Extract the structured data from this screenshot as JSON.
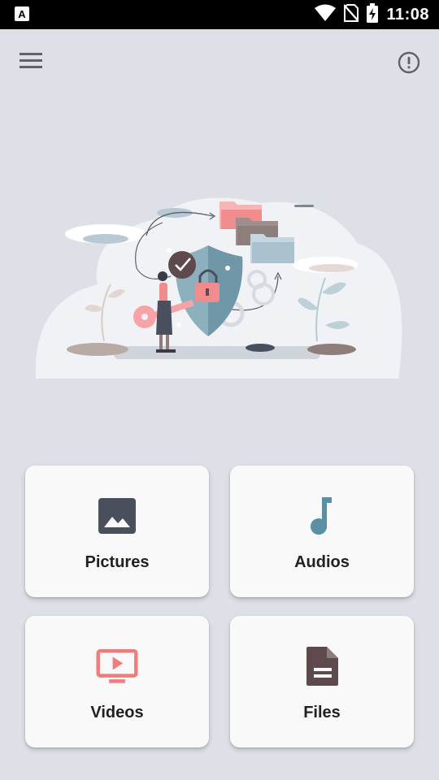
{
  "status_bar": {
    "time": "11:08",
    "left_icon": "a-notification-icon",
    "right_icons": [
      "wifi-icon",
      "no-sim-icon",
      "battery-charging-icon"
    ]
  },
  "top_bar": {
    "menu_icon": "hamburger-menu-icon",
    "info_icon": "info-circle-icon"
  },
  "hero": {
    "illustration": "security-illustration"
  },
  "categories": [
    {
      "label": "Pictures",
      "icon": "image-icon",
      "color": "#4a4f5e"
    },
    {
      "label": "Audios",
      "icon": "music-note-icon",
      "color": "#5a8fa5"
    },
    {
      "label": "Videos",
      "icon": "tv-play-icon",
      "color": "#f07c7e"
    },
    {
      "label": "Files",
      "icon": "document-icon",
      "color": "#5e4a4d"
    }
  ],
  "colors": {
    "background": "#dde1e7",
    "card": "#f9f9fa",
    "status_bar": "#000000"
  }
}
